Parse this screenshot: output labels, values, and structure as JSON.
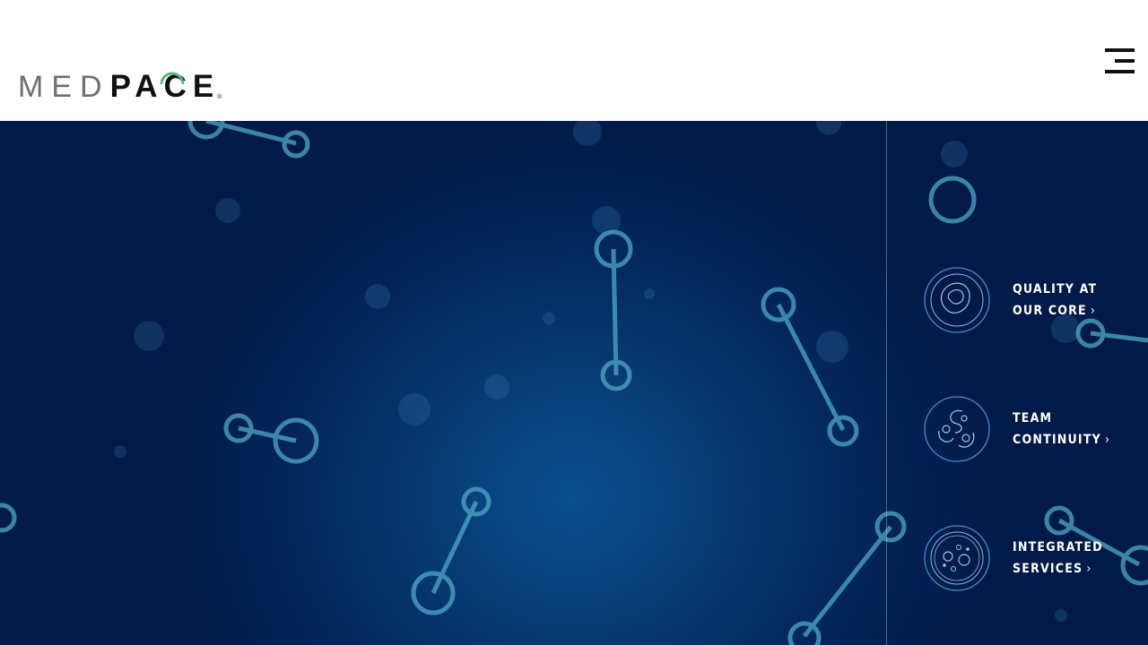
{
  "header": {
    "logo": {
      "text_light": "MED",
      "text_bold": "PACE",
      "registered": "®",
      "arc_color": "#5cb585"
    },
    "menu_icon": "hamburger-menu-icon"
  },
  "hero": {
    "colors": {
      "center": "#0a4f8e",
      "edge": "#021a48",
      "molecule": "#4fa8c8"
    },
    "features": [
      {
        "line1": "QUALITY AT",
        "line2": "OUR CORE",
        "icon": "shield-quality-icon"
      },
      {
        "line1": "TEAM",
        "line2": "CONTINUITY",
        "icon": "team-continuity-icon"
      },
      {
        "line1": "INTEGRATED",
        "line2": "SERVICES",
        "icon": "petri-dish-icon"
      }
    ],
    "chevron": "›"
  }
}
